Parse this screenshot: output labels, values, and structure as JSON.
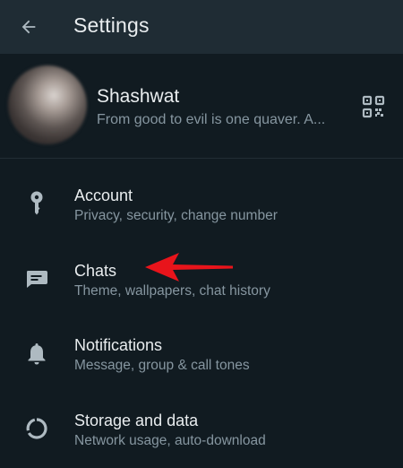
{
  "app_bar": {
    "title": "Settings",
    "back_icon": "arrow-back-icon"
  },
  "profile": {
    "name": "Shashwat",
    "about": "From good to evil is one quaver. A...",
    "qr_icon": "qr-code-icon"
  },
  "menu": {
    "items": [
      {
        "title": "Account",
        "subtitle": "Privacy, security, change number",
        "icon": "key-icon"
      },
      {
        "title": "Chats",
        "subtitle": "Theme, wallpapers, chat history",
        "icon": "chat-icon"
      },
      {
        "title": "Notifications",
        "subtitle": "Message, group & call tones",
        "icon": "bell-icon"
      },
      {
        "title": "Storage and data",
        "subtitle": "Network usage, auto-download",
        "icon": "storage-icon"
      }
    ]
  },
  "annotation": {
    "arrow_color": "#e8141b",
    "arrow_target": "Chats"
  },
  "colors": {
    "background": "#111b21",
    "app_bar": "#1f2c34",
    "primary_text": "#e9edef",
    "secondary_text": "#8696a0",
    "icon": "#aebac1"
  }
}
